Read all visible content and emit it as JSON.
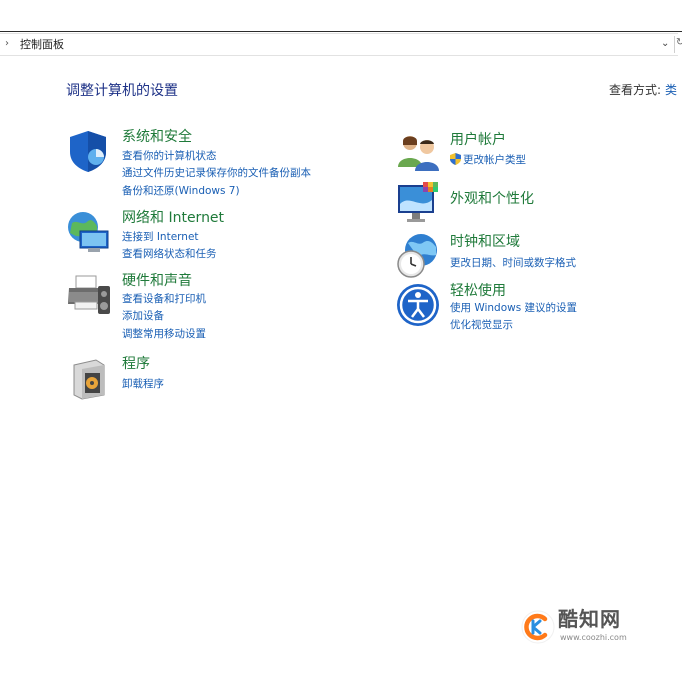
{
  "address": {
    "path": "控制面板"
  },
  "page": {
    "title": "调整计算机的设置",
    "view_by_label": "查看方式:",
    "view_by_value": "类"
  },
  "left": [
    {
      "title": "系统和安全",
      "links": [
        "查看你的计算机状态",
        "通过文件历史记录保存你的文件备份副本",
        "备份和还原(Windows 7)"
      ]
    },
    {
      "title": "网络和 Internet",
      "links": [
        "连接到 Internet",
        "查看网络状态和任务"
      ]
    },
    {
      "title": "硬件和声音",
      "links": [
        "查看设备和打印机",
        "添加设备",
        "调整常用移动设置"
      ]
    },
    {
      "title": "程序",
      "links": [
        "卸载程序"
      ]
    }
  ],
  "right": [
    {
      "title": "用户帐户",
      "links": [
        "更改帐户类型"
      ]
    },
    {
      "title": "外观和个性化",
      "links": []
    },
    {
      "title": "时钟和区域",
      "links": [
        "更改日期、时间或数字格式"
      ]
    },
    {
      "title": "轻松使用",
      "links": [
        "使用 Windows 建议的设置",
        "优化视觉显示"
      ]
    }
  ],
  "watermark": {
    "name": "酷知网",
    "url": "www.coozhi.com"
  },
  "colors": {
    "title_green": "#1f7a3a",
    "link_blue": "#1a5fb4",
    "heading_navy": "#1e3287"
  }
}
